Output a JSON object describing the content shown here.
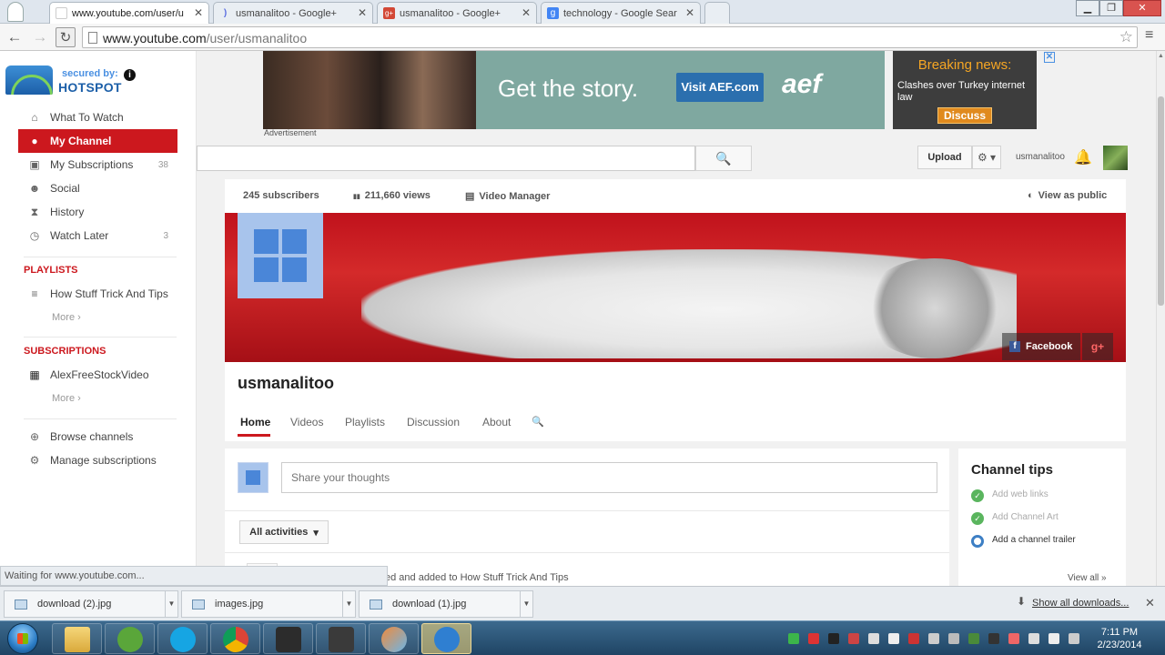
{
  "browser": {
    "tabs": [
      {
        "title": "www.youtube.com/user/u",
        "favicon_color": "#ffffff",
        "favicon_text": "",
        "active": true
      },
      {
        "title": "usmanalitoo - Google+",
        "favicon_color": "#5b6ee1",
        "favicon_text": ")",
        "active": false
      },
      {
        "title": "usmanalitoo - Google+",
        "favicon_color": "#d34836",
        "favicon_text": "g+",
        "active": false
      },
      {
        "title": "technology - Google Sear",
        "favicon_color": "#4285f4",
        "favicon_text": "g",
        "active": false
      }
    ],
    "url_host": "www.youtube.com",
    "url_path": "/user/usmanalitoo",
    "status_text": "Waiting for www.youtube.com..."
  },
  "guide": {
    "hotspot": {
      "secured_by": "secured by:",
      "brand": "HOTSPOT",
      "info": "i"
    },
    "main_items": [
      {
        "label": "What To Watch",
        "icon": "home-icon",
        "glyph": "⌂",
        "count": ""
      },
      {
        "label": "My Channel",
        "icon": "user-circle-icon",
        "glyph": "●",
        "count": "",
        "active": true
      },
      {
        "label": "My Subscriptions",
        "icon": "subscriptions-icon",
        "glyph": "▣",
        "count": "38"
      },
      {
        "label": "Social",
        "icon": "people-icon",
        "glyph": "☻",
        "count": ""
      },
      {
        "label": "History",
        "icon": "hourglass-icon",
        "glyph": "⧗",
        "count": ""
      },
      {
        "label": "Watch Later",
        "icon": "clock-icon",
        "glyph": "◷",
        "count": "3"
      }
    ],
    "playlists_heading": "PLAYLISTS",
    "playlists": [
      {
        "label": "How Stuff Trick And Tips",
        "icon": "list-icon",
        "glyph": "≡"
      }
    ],
    "playlists_more": "More ›",
    "subscriptions_heading": "SUBSCRIPTIONS",
    "subscriptions": [
      {
        "label": "AlexFreeStockVideo",
        "icon": "clapper-icon",
        "glyph": "▦"
      }
    ],
    "subscriptions_more": "More ›",
    "footer_items": [
      {
        "label": "Browse channels",
        "icon": "plus-circle-icon",
        "glyph": "⊕"
      },
      {
        "label": "Manage subscriptions",
        "icon": "gear-icon",
        "glyph": "⚙"
      }
    ]
  },
  "ads": {
    "banner_headline": "Get the story.",
    "banner_cta": "Visit AEF.com",
    "banner_logo": "aef",
    "advertisement_label": "Advertisement",
    "news_heading": "Breaking news:",
    "news_body": "Clashes over Turkey internet law",
    "news_cta": "Discuss",
    "close_glyph": "✕"
  },
  "header": {
    "search_placeholder": "",
    "search_glyph": "🔍",
    "upload_label": "Upload",
    "gear_glyph": "⚙ ▾",
    "username": "usmanalitoo",
    "bell_glyph": "🔔"
  },
  "channel": {
    "stats": [
      {
        "label": "245 subscribers",
        "icon": ""
      },
      {
        "label": "211,660 views",
        "icon": "bar-chart-icon",
        "glyph": "▮▮"
      },
      {
        "label": "Video Manager",
        "icon": "video-manager-icon",
        "glyph": "▤"
      }
    ],
    "view_as_public": "View as public",
    "view_as_public_glyph": "◐",
    "name": "usmanalitoo",
    "social": [
      {
        "label": "Facebook",
        "glyph": "f"
      },
      {
        "label": "",
        "glyph": "g+"
      }
    ],
    "tabs": [
      "Home",
      "Videos",
      "Playlists",
      "Discussion",
      "About"
    ],
    "search_glyph": "🔍"
  },
  "feed": {
    "thoughts_placeholder": "Share your thoughts",
    "activities_label": "All activities",
    "activities_caret": "▾",
    "item_text": "ed and added to How Stuff Trick And Tips"
  },
  "channel_tips": {
    "title": "Channel tips",
    "items": [
      {
        "label": "Add web links",
        "done": true
      },
      {
        "label": "Add Channel Art",
        "done": true
      },
      {
        "label": "Add a channel trailer",
        "done": false
      }
    ],
    "view_all": "View all  »"
  },
  "downloads": {
    "items": [
      "download (2).jpg",
      "images.jpg",
      "download (1).jpg"
    ],
    "show_all": "Show all downloads...",
    "close_glyph": "✕"
  },
  "taskbar": {
    "clock_time": "7:11 PM",
    "clock_date": "2/23/2014"
  },
  "colors": {
    "youtube_red": "#cc181e",
    "link_blue": "#4a86d8",
    "tip_green": "#5ab55e"
  }
}
